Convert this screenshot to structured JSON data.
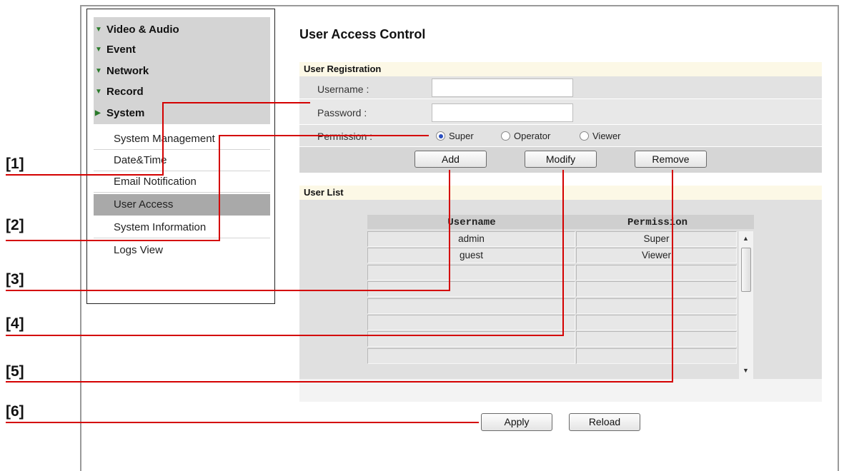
{
  "sidebar": {
    "menu": [
      {
        "label": "Video & Audio",
        "icon": "triangle-down-icon"
      },
      {
        "label": "Event",
        "icon": "triangle-down-icon"
      },
      {
        "label": "Network",
        "icon": "triangle-down-icon"
      },
      {
        "label": "Record",
        "icon": "triangle-down-icon"
      },
      {
        "label": "System",
        "icon": "triangle-right-icon"
      }
    ],
    "system_items": [
      {
        "label": "System Management"
      },
      {
        "label": "Date&Time"
      },
      {
        "label": "Email Notification"
      },
      {
        "label": "User Access",
        "active": true
      },
      {
        "label": "System Information"
      },
      {
        "label": "Logs View"
      }
    ]
  },
  "main": {
    "title": "User Access Control",
    "registration": {
      "heading": "User Registration",
      "username_label": "Username :",
      "username_value": "",
      "password_label": "Password :",
      "password_value": "",
      "permission_label": "Permission :",
      "permissions": [
        {
          "label": "Super",
          "selected": true
        },
        {
          "label": "Operator",
          "selected": false
        },
        {
          "label": "Viewer",
          "selected": false
        }
      ],
      "add_label": "Add",
      "modify_label": "Modify",
      "remove_label": "Remove"
    },
    "user_list": {
      "heading": "User List",
      "columns": [
        "Username",
        "Permission"
      ],
      "rows": [
        [
          "admin",
          "Super"
        ],
        [
          "guest",
          "Viewer"
        ],
        [
          "",
          ""
        ],
        [
          "",
          ""
        ],
        [
          "",
          ""
        ],
        [
          "",
          ""
        ],
        [
          "",
          ""
        ],
        [
          "",
          ""
        ]
      ]
    },
    "apply_label": "Apply",
    "reload_label": "Reload"
  },
  "callouts": [
    "[1]",
    "[2]",
    "[3]",
    "[4]",
    "[5]",
    "[6]"
  ],
  "colors": {
    "callout_line": "#d40000",
    "menu_band": "#d4d4d4",
    "active_item": "#a9a9a9",
    "section_head": "#fcf8e6",
    "row_bg": "#e2e2e2",
    "arrow": "#2a7a2a"
  }
}
